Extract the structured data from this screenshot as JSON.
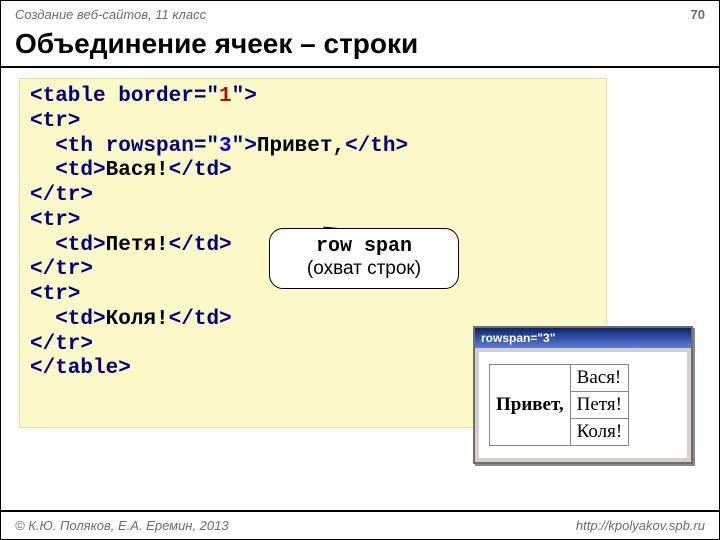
{
  "header": {
    "course": "Создание веб-сайтов, 11 класс",
    "page": "70"
  },
  "title": "Объединение ячеек – строки",
  "code": {
    "line1_open": "<table border=\"",
    "line1_val": "1",
    "line1_close": "\">",
    "line2": "<tr>",
    "line3_a": "  <th rowspan=\"",
    "line3_b": "3",
    "line3_c": "\">",
    "line3_txt": "Привет,",
    "line3_end": "</th>",
    "line4_a": "  <td>",
    "line4_txt": "Вася!",
    "line4_end": "</td>",
    "line5": "</tr>",
    "line6": "<tr>",
    "line7_a": "  <td>",
    "line7_txt": "Петя!",
    "line7_end": "</td>",
    "line8": "</tr>",
    "line9": "<tr>",
    "line10_a": "  <td>",
    "line10_txt": "Коля!",
    "line10_end": "</td>",
    "line11": "</tr>",
    "line12": "</table>"
  },
  "bubble": {
    "line1": "row span",
    "line2": "(охват строк)"
  },
  "browser": {
    "title": "rowspan=\"3\"",
    "th": "Привет,",
    "r1": "Вася!",
    "r2": "Петя!",
    "r3": "Коля!"
  },
  "footer": {
    "copyright": "© К.Ю. Поляков, Е.А. Еремин, 2013",
    "url": "http://kpolyakov.spb.ru"
  }
}
